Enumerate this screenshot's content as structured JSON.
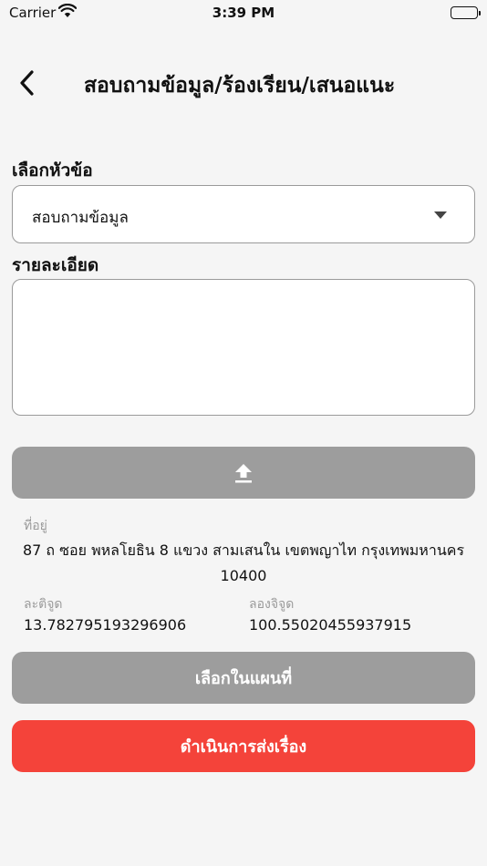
{
  "status_bar": {
    "carrier": "Carrier",
    "time": "3:39 PM"
  },
  "nav": {
    "title": "สอบถามข้อมูล/ร้องเรียน/เสนอแนะ"
  },
  "form": {
    "topic_label": "เลือกหัวข้อ",
    "topic_value": "สอบถามข้อมูล",
    "detail_label": "รายละเอียด",
    "detail_value": ""
  },
  "location": {
    "address_label": "ที่อยู่",
    "address_line1": "87 ถ ซอย พหลโยธิน 8 แขวง สามเสนใน เขตพญาไท กรุงเทพมหานคร",
    "address_line2": "10400",
    "lat_label": "ละติจูด",
    "lat_value": "13.782795193296906",
    "lng_label": "ลองจิจูด",
    "lng_value": "100.55020455937915"
  },
  "buttons": {
    "map_label": "เลือกในแผนที่",
    "submit_label": "ดำเนินการส่งเรื่อง"
  },
  "icons": {
    "back": "chevron-left-icon",
    "dropdown": "caret-down-icon",
    "upload": "upload-icon"
  },
  "colors": {
    "primary_red": "#f4433a",
    "disabled_grey": "#9d9d9d"
  }
}
